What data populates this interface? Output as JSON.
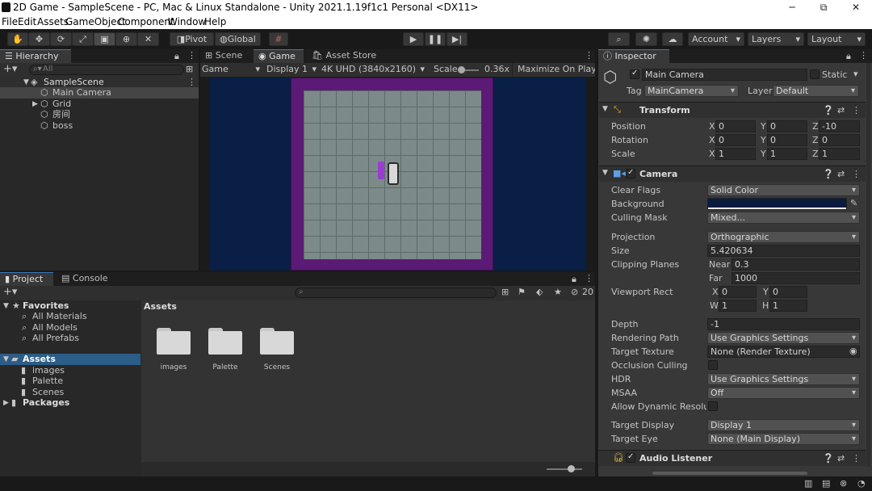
{
  "window": {
    "title": "2D Game - SampleScene - PC, Mac & Linux Standalone - Unity 2021.1.19f1c1 Personal <DX11>",
    "minimize": "─",
    "restore": "⧉",
    "close": "✕"
  },
  "menu": [
    "File",
    "Edit",
    "Assets",
    "GameObject",
    "Component",
    "Window",
    "Help"
  ],
  "toolbar": {
    "pivot": "Pivot",
    "global": "Global",
    "account": "Account",
    "layers": "Layers",
    "layout": "Layout"
  },
  "hierarchy": {
    "tab": "Hierarchy",
    "search_placeholder": "All",
    "scene": "SampleScene",
    "items": [
      "Main Camera",
      "Grid",
      "房间",
      "boss"
    ]
  },
  "center": {
    "tabs": [
      "Scene",
      "Game",
      "Asset Store"
    ],
    "display_mode": "Game",
    "display": "Display 1",
    "resolution": "4K UHD (3840x2160)",
    "scale_label": "Scale",
    "scale_value": "0.36x",
    "maximize": "Maximize On Play"
  },
  "project": {
    "tabs": [
      "Project",
      "Console"
    ],
    "favorites_label": "Favorites",
    "favorites": [
      "All Materials",
      "All Models",
      "All Prefabs"
    ],
    "assets_label": "Assets",
    "asset_folders": [
      "images",
      "Palette",
      "Scenes"
    ],
    "packages_label": "Packages",
    "breadcrumb": "Assets",
    "grid_items": [
      "images",
      "Palette",
      "Scenes"
    ],
    "hidden_count": "20"
  },
  "inspector": {
    "tab": "Inspector",
    "object_name": "Main Camera",
    "static_label": "Static",
    "tag_label": "Tag",
    "tag_value": "MainCamera",
    "layer_label": "Layer",
    "layer_value": "Default",
    "transform": {
      "title": "Transform",
      "position_label": "Position",
      "rotation_label": "Rotation",
      "scale_label": "Scale",
      "position": [
        "0",
        "0",
        "-10"
      ],
      "rotation": [
        "0",
        "0",
        "0"
      ],
      "scale": [
        "1",
        "1",
        "1"
      ],
      "axes": [
        "X",
        "Y",
        "Z"
      ]
    },
    "camera": {
      "title": "Camera",
      "rows": [
        {
          "label": "Clear Flags",
          "value": "Solid Color"
        },
        {
          "label": "Background",
          "value": ""
        },
        {
          "label": "Culling Mask",
          "value": "Mixed..."
        },
        {
          "label": "Projection",
          "value": "Orthographic"
        },
        {
          "label": "Size",
          "value": "5.420634"
        },
        {
          "label": "Clipping Planes",
          "value": ""
        },
        {
          "label": "Viewport Rect",
          "value": ""
        },
        {
          "label": "Depth",
          "value": "-1"
        },
        {
          "label": "Rendering Path",
          "value": "Use Graphics Settings"
        },
        {
          "label": "Target Texture",
          "value": "None (Render Texture)"
        },
        {
          "label": "Occlusion Culling",
          "value": ""
        },
        {
          "label": "HDR",
          "value": "Use Graphics Settings"
        },
        {
          "label": "MSAA",
          "value": "Off"
        },
        {
          "label": "Allow Dynamic Resolutio",
          "value": ""
        },
        {
          "label": "Target Display",
          "value": "Display 1"
        },
        {
          "label": "Target Eye",
          "value": "None (Main Display)"
        }
      ],
      "near_label": "Near",
      "near_value": "0.3",
      "far_label": "Far",
      "far_value": "1000",
      "vp_x_label": "X",
      "vp_x": "0",
      "vp_y_label": "Y",
      "vp_y": "0",
      "vp_w_label": "W",
      "vp_w": "1",
      "vp_h_label": "H",
      "vp_h": "1"
    },
    "audio_listener": "Audio Listener"
  },
  "colors": {
    "game_bg": "#0a1f46",
    "room_wall": "#5b1a75",
    "floor": "#7d8a8a",
    "selection": "#2c5d87"
  }
}
